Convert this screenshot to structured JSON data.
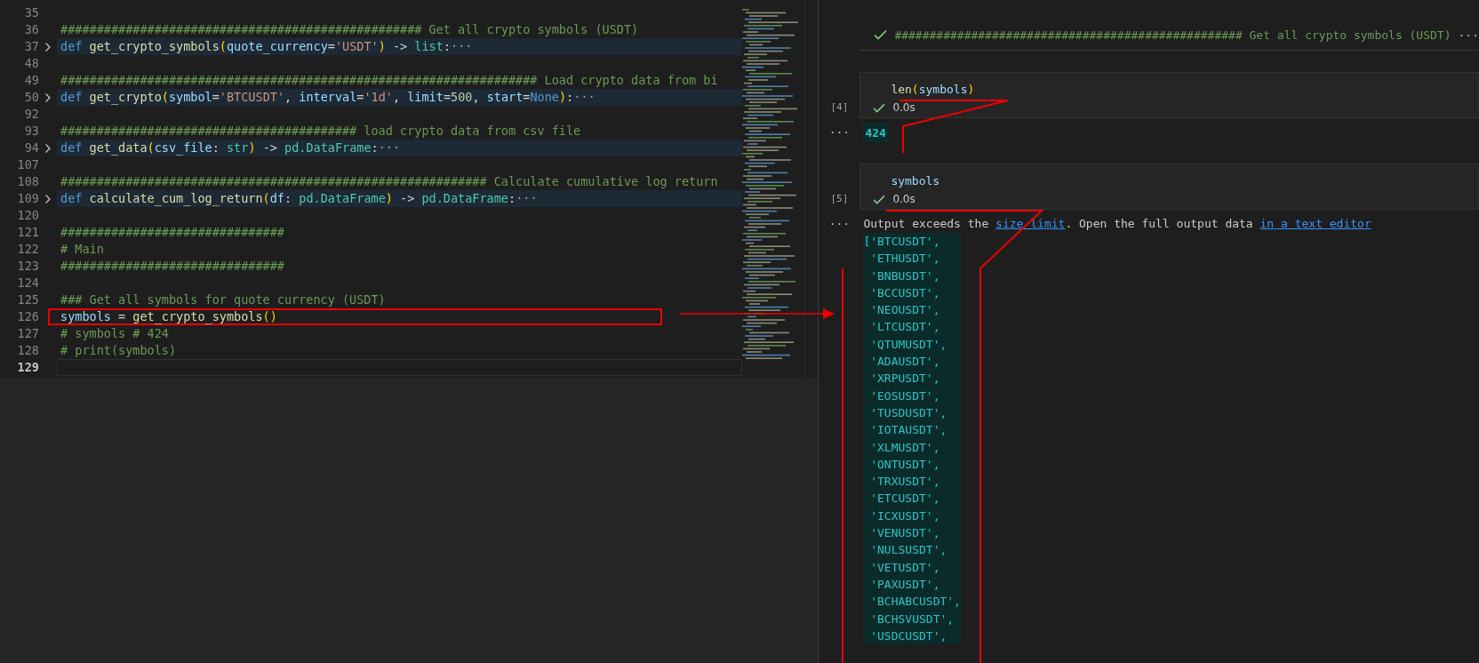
{
  "editor": {
    "lines": [
      {
        "number": "35",
        "folded": false,
        "current": false,
        "annotated": false
      },
      {
        "number": "36",
        "folded": false,
        "current": false,
        "annotated": false,
        "tokens": [
          {
            "kind": "comment",
            "text": "################################################## Get all crypto symbols (USDT)"
          }
        ]
      },
      {
        "number": "37",
        "folded": true,
        "current": false,
        "annotated": false,
        "tokens": [
          {
            "kind": "keyword",
            "text": "def "
          },
          {
            "kind": "function",
            "text": "get_crypto_symbols"
          },
          {
            "kind": "bracket",
            "text": "("
          },
          {
            "kind": "param",
            "text": "quote_currency"
          },
          {
            "kind": "plain",
            "text": "="
          },
          {
            "kind": "string",
            "text": "'USDT'"
          },
          {
            "kind": "bracket",
            "text": ")"
          },
          {
            "kind": "plain",
            "text": " -> "
          },
          {
            "kind": "type",
            "text": "list"
          },
          {
            "kind": "plain",
            "text": ":"
          },
          {
            "kind": "ellipsis",
            "text": "···"
          }
        ]
      },
      {
        "number": "48",
        "folded": false,
        "current": false,
        "annotated": false
      },
      {
        "number": "49",
        "folded": false,
        "current": false,
        "annotated": false,
        "tokens": [
          {
            "kind": "comment",
            "text": "################################################################## Load crypto data from bi"
          }
        ]
      },
      {
        "number": "50",
        "folded": true,
        "current": false,
        "annotated": false,
        "tokens": [
          {
            "kind": "keyword",
            "text": "def "
          },
          {
            "kind": "function",
            "text": "get_crypto"
          },
          {
            "kind": "bracket",
            "text": "("
          },
          {
            "kind": "param",
            "text": "symbol"
          },
          {
            "kind": "plain",
            "text": "="
          },
          {
            "kind": "string",
            "text": "'BTCUSDT'"
          },
          {
            "kind": "plain",
            "text": ", "
          },
          {
            "kind": "param",
            "text": "interval"
          },
          {
            "kind": "plain",
            "text": "="
          },
          {
            "kind": "string",
            "text": "'1d'"
          },
          {
            "kind": "plain",
            "text": ", "
          },
          {
            "kind": "param",
            "text": "limit"
          },
          {
            "kind": "plain",
            "text": "="
          },
          {
            "kind": "number",
            "text": "500"
          },
          {
            "kind": "plain",
            "text": ", "
          },
          {
            "kind": "param",
            "text": "start"
          },
          {
            "kind": "plain",
            "text": "="
          },
          {
            "kind": "keyword",
            "text": "None"
          },
          {
            "kind": "bracket",
            "text": ")"
          },
          {
            "kind": "plain",
            "text": ":"
          },
          {
            "kind": "ellipsis",
            "text": "···"
          }
        ]
      },
      {
        "number": "92",
        "folded": false,
        "current": false,
        "annotated": false
      },
      {
        "number": "93",
        "folded": false,
        "current": false,
        "annotated": false,
        "tokens": [
          {
            "kind": "comment",
            "text": "######################################### load crypto data from csv file"
          }
        ]
      },
      {
        "number": "94",
        "folded": true,
        "current": false,
        "annotated": false,
        "tokens": [
          {
            "kind": "keyword",
            "text": "def "
          },
          {
            "kind": "function",
            "text": "get_data"
          },
          {
            "kind": "bracket",
            "text": "("
          },
          {
            "kind": "param",
            "text": "csv_file"
          },
          {
            "kind": "plain",
            "text": ": "
          },
          {
            "kind": "type",
            "text": "str"
          },
          {
            "kind": "bracket",
            "text": ")"
          },
          {
            "kind": "plain",
            "text": " -> "
          },
          {
            "kind": "type",
            "text": "pd.DataFrame"
          },
          {
            "kind": "plain",
            "text": ":"
          },
          {
            "kind": "ellipsis",
            "text": "···"
          }
        ]
      },
      {
        "number": "107",
        "folded": false,
        "current": false,
        "annotated": false
      },
      {
        "number": "108",
        "folded": false,
        "current": false,
        "annotated": false,
        "tokens": [
          {
            "kind": "comment",
            "text": "########################################################### Calculate cumulative log return"
          }
        ]
      },
      {
        "number": "109",
        "folded": true,
        "current": false,
        "annotated": false,
        "tokens": [
          {
            "kind": "keyword",
            "text": "def "
          },
          {
            "kind": "function",
            "text": "calculate_cum_log_return"
          },
          {
            "kind": "bracket",
            "text": "("
          },
          {
            "kind": "param",
            "text": "df"
          },
          {
            "kind": "plain",
            "text": ": "
          },
          {
            "kind": "type",
            "text": "pd.DataFrame"
          },
          {
            "kind": "bracket",
            "text": ")"
          },
          {
            "kind": "plain",
            "text": " -> "
          },
          {
            "kind": "type",
            "text": "pd.DataFrame"
          },
          {
            "kind": "plain",
            "text": ":"
          },
          {
            "kind": "ellipsis",
            "text": "···"
          }
        ]
      },
      {
        "number": "120",
        "folded": false,
        "current": false,
        "annotated": false
      },
      {
        "number": "121",
        "folded": false,
        "current": false,
        "annotated": false,
        "tokens": [
          {
            "kind": "comment",
            "text": "###############################"
          }
        ]
      },
      {
        "number": "122",
        "folded": false,
        "current": false,
        "annotated": false,
        "tokens": [
          {
            "kind": "comment",
            "text": "# Main"
          }
        ]
      },
      {
        "number": "123",
        "folded": false,
        "current": false,
        "annotated": false,
        "tokens": [
          {
            "kind": "comment",
            "text": "###############################"
          }
        ]
      },
      {
        "number": "124",
        "folded": false,
        "current": false,
        "annotated": false
      },
      {
        "number": "125",
        "folded": false,
        "current": false,
        "annotated": false,
        "tokens": [
          {
            "kind": "comment",
            "text": "### Get all symbols for quote currency (USDT)"
          }
        ]
      },
      {
        "number": "126",
        "folded": false,
        "current": false,
        "annotated": true,
        "tokens": [
          {
            "kind": "param",
            "text": "symbols"
          },
          {
            "kind": "plain",
            "text": " = "
          },
          {
            "kind": "function",
            "text": "get_crypto_symbols"
          },
          {
            "kind": "bracket",
            "text": "()"
          }
        ]
      },
      {
        "number": "127",
        "folded": false,
        "current": false,
        "annotated": false,
        "tokens": [
          {
            "kind": "comment",
            "text": "# symbols # 424"
          }
        ]
      },
      {
        "number": "128",
        "folded": false,
        "current": false,
        "annotated": false,
        "tokens": [
          {
            "kind": "comment",
            "text": "# print(symbols)"
          }
        ]
      },
      {
        "number": "129",
        "folded": false,
        "current": true,
        "annotated": false
      }
    ]
  },
  "notebook": {
    "cells": [
      {
        "kind": "collapsed",
        "succeeded": true,
        "text": "################################################## Get all crypto symbols (USDT)",
        "more": "···"
      },
      {
        "kind": "code",
        "execution_count": "[4]",
        "succeeded": true,
        "duration": "0.0s",
        "tokens": [
          {
            "kind": "function",
            "text": "len"
          },
          {
            "kind": "bracket",
            "text": "("
          },
          {
            "kind": "param",
            "text": "symbols"
          },
          {
            "kind": "bracket",
            "text": ")"
          }
        ],
        "output": {
          "more": "···",
          "kind": "value",
          "text": "424"
        }
      },
      {
        "kind": "code",
        "execution_count": "[5]",
        "succeeded": true,
        "duration": "0.0s",
        "tokens": [
          {
            "kind": "param",
            "text": "symbols"
          }
        ],
        "output": {
          "more": "···",
          "kind": "list",
          "message": [
            {
              "kind": "text",
              "text": "Output exceeds the "
            },
            {
              "kind": "link",
              "text": "size limit"
            },
            {
              "kind": "text",
              "text": ". Open the full output data "
            },
            {
              "kind": "link",
              "text": "in a text editor"
            }
          ],
          "items": [
            "['BTCUSDT',",
            " 'ETHUSDT',",
            " 'BNBUSDT',",
            " 'BCCUSDT',",
            " 'NEOUSDT',",
            " 'LTCUSDT',",
            " 'QTUMUSDT',",
            " 'ADAUSDT',",
            " 'XRPUSDT',",
            " 'EOSUSDT',",
            " 'TUSDUSDT',",
            " 'IOTAUSDT',",
            " 'XLMUSDT',",
            " 'ONTUSDT',",
            " 'TRXUSDT',",
            " 'ETCUSDT',",
            " 'ICXUSDT',",
            " 'VENUSDT',",
            " 'NULSUSDT',",
            " 'VETUSDT',",
            " 'PAXUSDT',",
            " 'BCHABCUSDT',",
            " 'BCHSVUSDT',",
            " 'USDCUSDT',"
          ]
        }
      }
    ]
  }
}
